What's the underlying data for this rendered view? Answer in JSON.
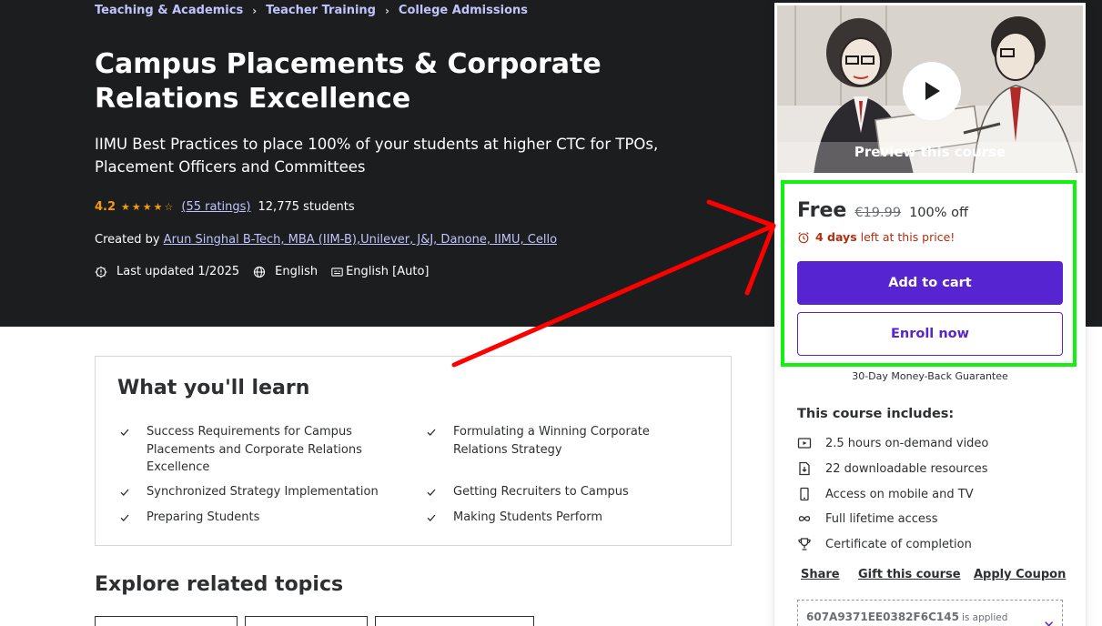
{
  "breadcrumb": [
    {
      "label": "Teaching & Academics"
    },
    {
      "label": "Teacher Training"
    },
    {
      "label": "College Admissions"
    }
  ],
  "course": {
    "title": "Campus Placements & Corporate Relations Excellence",
    "subtitle": "IIMU Best Practices to place 100% of your students at higher CTC for TPOs, Placement Officers and Committees",
    "rating": "4.2",
    "rating_stars": 4.2,
    "ratings_count": "(55 ratings)",
    "students": "12,775 students",
    "created_by_label": "Created by",
    "author": "Arun Singhal B-Tech, MBA (IIM-B),Unilever, J&J, Danone, IIMU, Cello",
    "last_updated": "Last updated 1/2025",
    "language": "English",
    "captions": "English [Auto]"
  },
  "learn": {
    "title": "What you'll learn",
    "items": [
      "Success Requirements for Campus Placements and Corporate Relations Excellence",
      "Formulating a Winning Corporate Relations Strategy",
      "Synchronized Strategy Implementation",
      "Getting Recruiters to Campus",
      "Preparing Students",
      "Making Students Perform"
    ]
  },
  "related": {
    "title": "Explore related topics"
  },
  "sidebar": {
    "preview_label": "Preview this course",
    "price": "Free",
    "original_price": "€19.99",
    "discount": "100% off",
    "timer_bold": "4 days",
    "timer_rest": "left at this price!",
    "add_to_cart": "Add to cart",
    "enroll_now": "Enroll now",
    "guarantee": "30-Day Money-Back Guarantee",
    "includes_title": "This course includes:",
    "includes": [
      {
        "icon": "video-icon",
        "label": "2.5 hours on-demand video"
      },
      {
        "icon": "download-file-icon",
        "label": "22 downloadable resources"
      },
      {
        "icon": "mobile-icon",
        "label": "Access on mobile and TV"
      },
      {
        "icon": "infinity-icon",
        "label": "Full lifetime access"
      },
      {
        "icon": "trophy-icon",
        "label": "Certificate of completion"
      }
    ],
    "share": "Share",
    "gift": "Gift this course",
    "apply_coupon": "Apply Coupon",
    "coupon_code": "607A9371EE0382F6C145",
    "coupon_status": "is applied"
  },
  "colors": {
    "hero_bg": "#1c1d1f",
    "accent_purple": "#5624d0",
    "link_lavender": "#c0c4fc",
    "star_orange": "#f69c08",
    "timer_red": "#b32d0f",
    "highlight_green": "#14f00f",
    "arrow_red": "#ff0000"
  }
}
